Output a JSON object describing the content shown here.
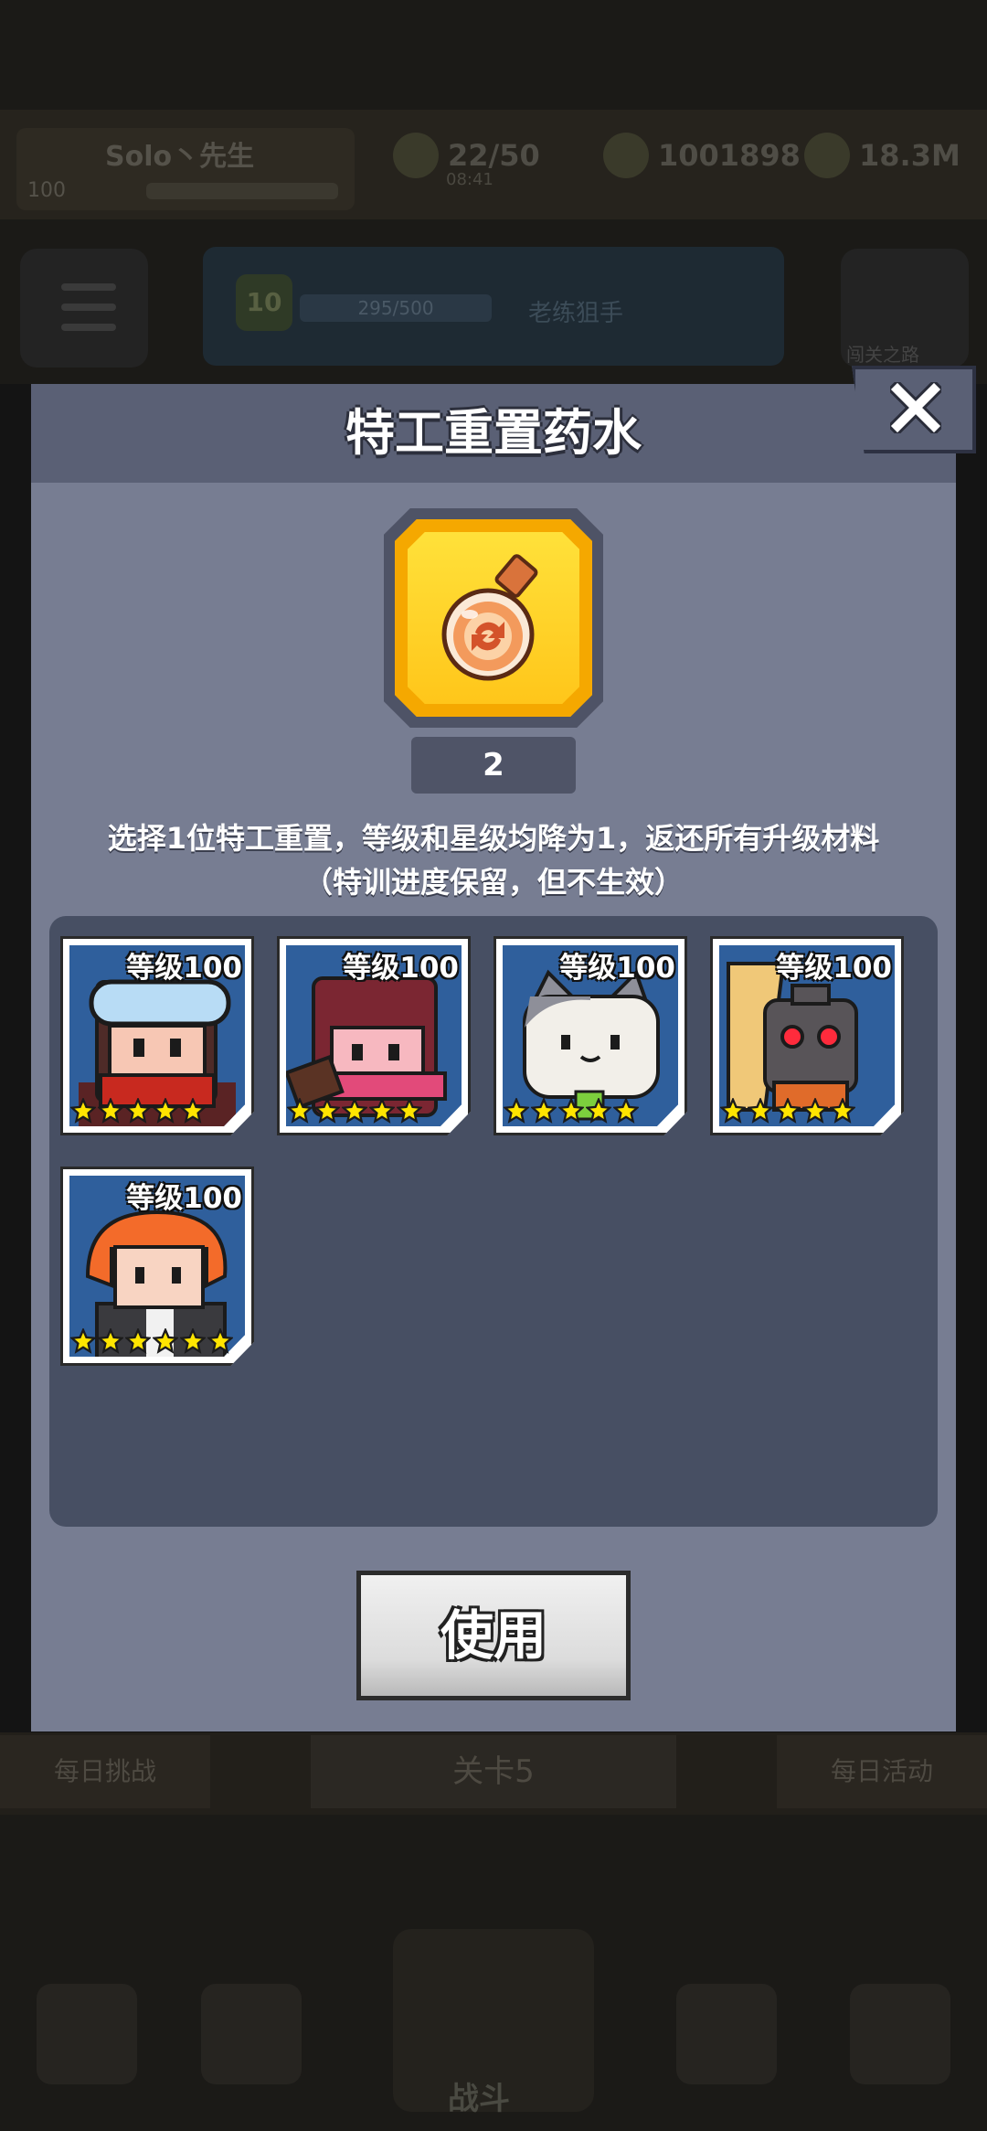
{
  "background": {
    "player_name": "Solo丶先生",
    "player_level": "100",
    "energy": "22/50",
    "energy_timer": "08:41",
    "gold": "1001898",
    "cash": "18.3M",
    "rank_level": "10",
    "rank_progress": "295/500",
    "rank_title": "老练狙手",
    "right_label": "闯关之路",
    "bottom_left": "每日挑战",
    "bottom_mid": "关卡5",
    "bottom_right": "每日活动",
    "nav_battle": "战斗"
  },
  "modal": {
    "title": "特工重置药水",
    "item_icon": "reset-potion-icon",
    "item_count": "2",
    "description_line1": "选择1位特工重置，等级和星级均降为1，返还所有升级材料",
    "description_line2": "（特训进度保留，但不生效）",
    "use_button": "使用",
    "close_icon": "close-icon"
  },
  "agents": [
    {
      "level_label": "等级100",
      "stars": 5,
      "avatar": "goggles-agent",
      "accent": "#4e2b28"
    },
    {
      "level_label": "等级100",
      "stars": 5,
      "avatar": "ninja-girl-agent",
      "accent": "#7b2632"
    },
    {
      "level_label": "等级100",
      "stars": 5,
      "avatar": "cat-agent",
      "accent": "#8e8f99"
    },
    {
      "level_label": "等级100",
      "stars": 5,
      "avatar": "robot-agent",
      "accent": "#f0c878"
    },
    {
      "level_label": "等级100",
      "stars": 6,
      "avatar": "redhead-agent",
      "accent": "#f36b2a"
    }
  ],
  "colors": {
    "modal_bg": "#777d92",
    "header_bg": "#5a6075",
    "panel_bg": "#474f63",
    "item_gold": "#ffc61a",
    "card_art_bg": "#2f5f9c",
    "star": "#ffe500"
  }
}
